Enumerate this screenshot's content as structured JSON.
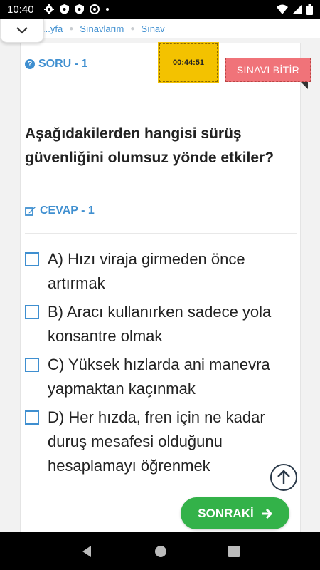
{
  "status_bar": {
    "time": "10:40",
    "icons_left": [
      "settings-icon",
      "shield-icon",
      "shield-icon",
      "at-sign-icon",
      "dot-icon"
    ],
    "icons_right": [
      "wifi-icon",
      "signal-icon",
      "battery-icon"
    ]
  },
  "breadcrumb": {
    "items": [
      "...yfa",
      "Sınavlarım",
      "Sınav"
    ]
  },
  "exam": {
    "question_label": "SORU - 1",
    "timer": "00:44:51",
    "finish_label": "SINAVI BİTİR",
    "question_text": "Aşağıdakilerden hangisi sürüş güvenliğini olumsuz yönde etkiler?",
    "answer_label": "CEVAP - 1",
    "options": [
      "A) Hızı viraja girmeden önce artırmak",
      "B) Aracı kullanırken sadece yola konsantre olmak",
      "C) Yüksek hızlarda ani manevra yapmaktan kaçınmak",
      "D) Her hızda, fren için ne kadar duruş mesafesi olduğunu hesaplamayı öğrenmek"
    ],
    "next_label": "SONRAKİ"
  },
  "colors": {
    "accent": "#3f8fd0",
    "timer": "#f3c200",
    "finish": "#f07379",
    "next": "#33b249"
  }
}
